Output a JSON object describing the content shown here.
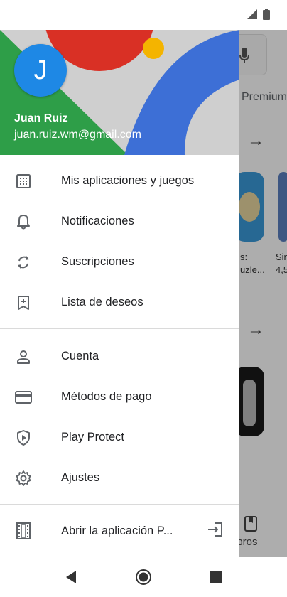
{
  "account": {
    "initial": "J",
    "name": "Juan Ruiz",
    "email": "juan.ruiz.wm@gmail.com"
  },
  "menu_group1": [
    {
      "label": "Mis aplicaciones y juegos",
      "icon": "apps-grid-icon"
    },
    {
      "label": "Notificaciones",
      "icon": "bell-icon"
    },
    {
      "label": "Suscripciones",
      "icon": "refresh-icon"
    },
    {
      "label": "Lista de deseos",
      "icon": "bookmark-add-icon"
    }
  ],
  "menu_group2": [
    {
      "label": "Cuenta",
      "icon": "person-icon"
    },
    {
      "label": "Métodos de pago",
      "icon": "credit-card-icon"
    },
    {
      "label": "Play Protect",
      "icon": "shield-play-icon"
    },
    {
      "label": "Ajustes",
      "icon": "gear-icon"
    }
  ],
  "open_app": {
    "label": "Abrir la aplicación P...",
    "icon": "film-icon",
    "action_icon": "exit-icon"
  },
  "background": {
    "premium": "Premium",
    "tile1_title": "s:",
    "tile1_sub": "uzle...",
    "tile2_title": "Sin",
    "tile2_sub": "4,5",
    "libros": "ibros"
  },
  "colors": {
    "avatar": "#1e88e5",
    "header_green": "#2e9e48",
    "header_red": "#d93025",
    "header_blue": "#3d6fd6",
    "header_yellow": "#f4b400"
  }
}
